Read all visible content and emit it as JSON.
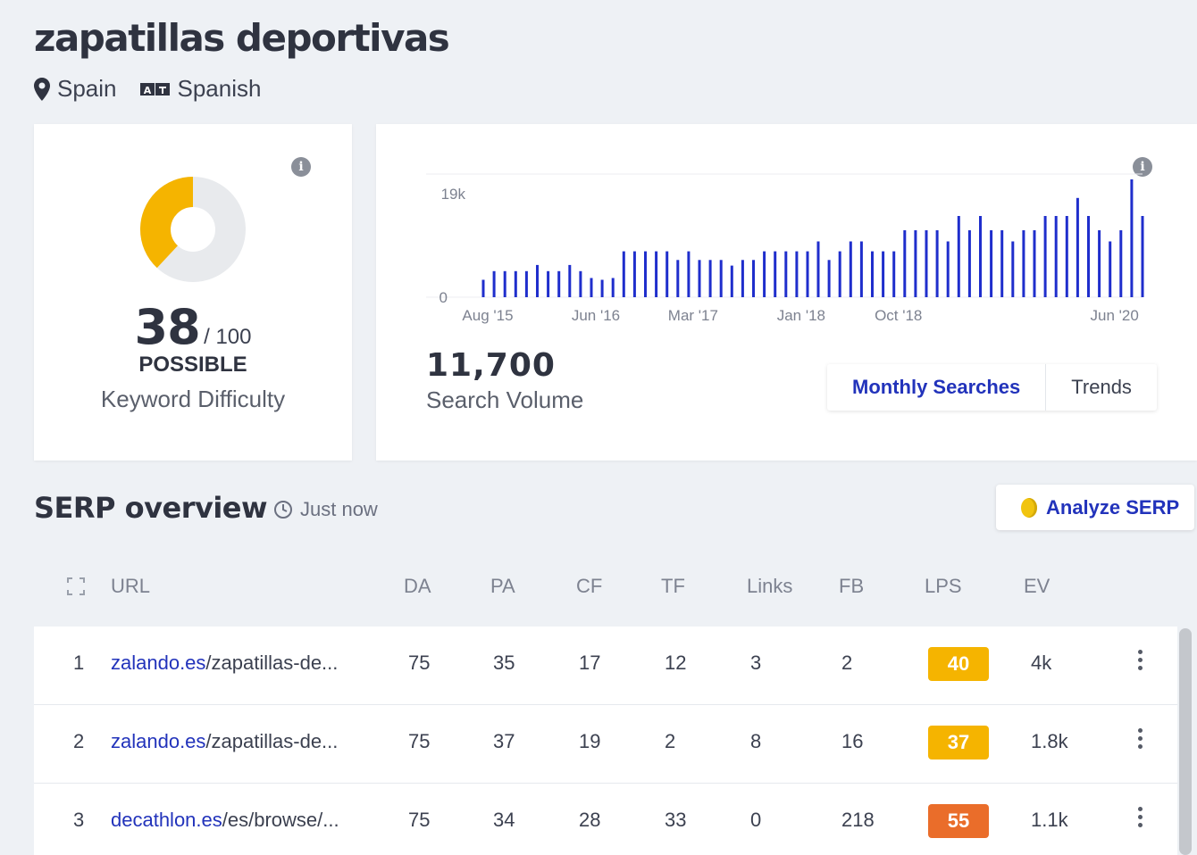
{
  "keyword": "zapatillas deportivas",
  "location": {
    "country": "Spain",
    "language": "Spanish"
  },
  "difficulty": {
    "score": 38,
    "score_label": "38",
    "of_label": "/ 100",
    "level": "POSSIBLE",
    "caption": "Keyword Difficulty",
    "gauge_color": "#f5b400"
  },
  "volume": {
    "value": "11,700",
    "caption": "Search Volume"
  },
  "tabs": [
    {
      "label": "Monthly Searches",
      "active": true
    },
    {
      "label": "Trends",
      "active": false
    }
  ],
  "chart_data": {
    "type": "bar",
    "title": "",
    "ylabel": "",
    "xlabel": "",
    "ylim": [
      0,
      19000
    ],
    "y_ticks": [
      "0",
      "19k"
    ],
    "x_ticks": [
      "Aug '15",
      "Jun '16",
      "Mar '17",
      "Jan '18",
      "Oct '18",
      "Jun '20"
    ],
    "color": "#1f2ecc",
    "values": [
      2800,
      4200,
      4200,
      4200,
      4200,
      5200,
      4200,
      4200,
      5200,
      4200,
      3100,
      2800,
      3100,
      7400,
      7400,
      7400,
      7400,
      7400,
      6000,
      7400,
      6000,
      6000,
      6000,
      5100,
      6000,
      6000,
      7400,
      7400,
      7400,
      7400,
      7400,
      9000,
      6000,
      7400,
      9000,
      9000,
      7400,
      7400,
      7400,
      10800,
      10800,
      10800,
      10800,
      9000,
      13100,
      10800,
      13100,
      10800,
      10800,
      9000,
      10800,
      10800,
      13100,
      13100,
      13100,
      16000,
      13100,
      10800,
      9000,
      10800,
      19000,
      13100
    ]
  },
  "serp": {
    "title": "SERP overview",
    "updated": "Just now",
    "analyze_label": "Analyze SERP",
    "columns": [
      "URL",
      "DA",
      "PA",
      "CF",
      "TF",
      "Links",
      "FB",
      "LPS",
      "EV"
    ],
    "rows": [
      {
        "rank": "1",
        "domain": "zalando.es",
        "path": "/zapatillas-de...",
        "da": "75",
        "pa": "35",
        "cf": "17",
        "tf": "12",
        "links": "3",
        "fb": "2",
        "lps": "40",
        "lps_color": "#f5b400",
        "ev": "4k"
      },
      {
        "rank": "2",
        "domain": "zalando.es",
        "path": "/zapatillas-de...",
        "da": "75",
        "pa": "37",
        "cf": "19",
        "tf": "2",
        "links": "8",
        "fb": "16",
        "lps": "37",
        "lps_color": "#f5b400",
        "ev": "1.8k"
      },
      {
        "rank": "3",
        "domain": "decathlon.es",
        "path": "/es/browse/...",
        "da": "75",
        "pa": "34",
        "cf": "28",
        "tf": "33",
        "links": "0",
        "fb": "218",
        "lps": "55",
        "lps_color": "#ea6d2a",
        "ev": "1.1k"
      }
    ]
  }
}
